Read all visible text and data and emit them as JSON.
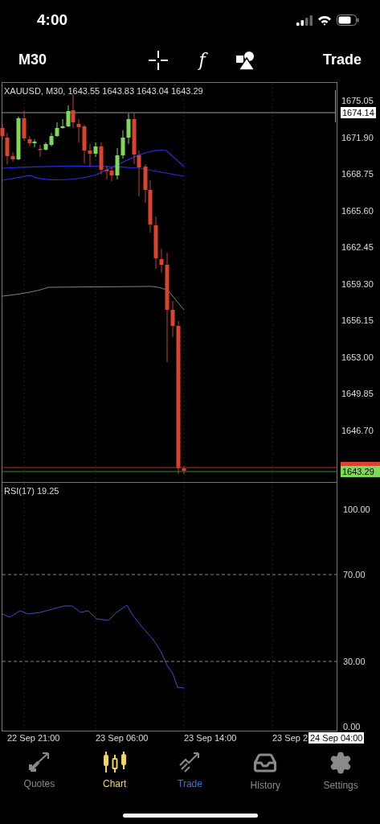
{
  "status_bar": {
    "time": "4:00"
  },
  "toolbar": {
    "timeframe": "M30",
    "function_symbol": "f",
    "trade": "Trade"
  },
  "chart": {
    "title": "XAUUSD, M30, 1643.55 1643.83 1643.04 1643.29",
    "price_labels": [
      "1675.05",
      "1671.90",
      "1668.75",
      "1665.60",
      "1662.45",
      "1659.30",
      "1656.15",
      "1653.00",
      "1649.85",
      "1646.70"
    ],
    "marker_high": "1674.14",
    "marker_last": "1643.29"
  },
  "rsi": {
    "title": "RSI(17) 19.25",
    "levels": [
      "100.00",
      "70.00",
      "30.00",
      "0.00"
    ]
  },
  "time_labels": [
    "22 Sep 21:00",
    "23 Sep 06:00",
    "23 Sep 14:00",
    "23 Sep 2"
  ],
  "time_cursor": "24 Sep 04:00",
  "tabs": [
    {
      "label": "Quotes",
      "kind": "quotes",
      "selected": false,
      "highlighted": false
    },
    {
      "label": "Chart",
      "kind": "chart",
      "selected": true,
      "highlighted": false
    },
    {
      "label": "Trade",
      "kind": "trade",
      "selected": false,
      "highlighted": true
    },
    {
      "label": "History",
      "kind": "history",
      "selected": false,
      "highlighted": false
    },
    {
      "label": "Settings",
      "kind": "settings",
      "selected": false,
      "highlighted": false
    }
  ]
}
